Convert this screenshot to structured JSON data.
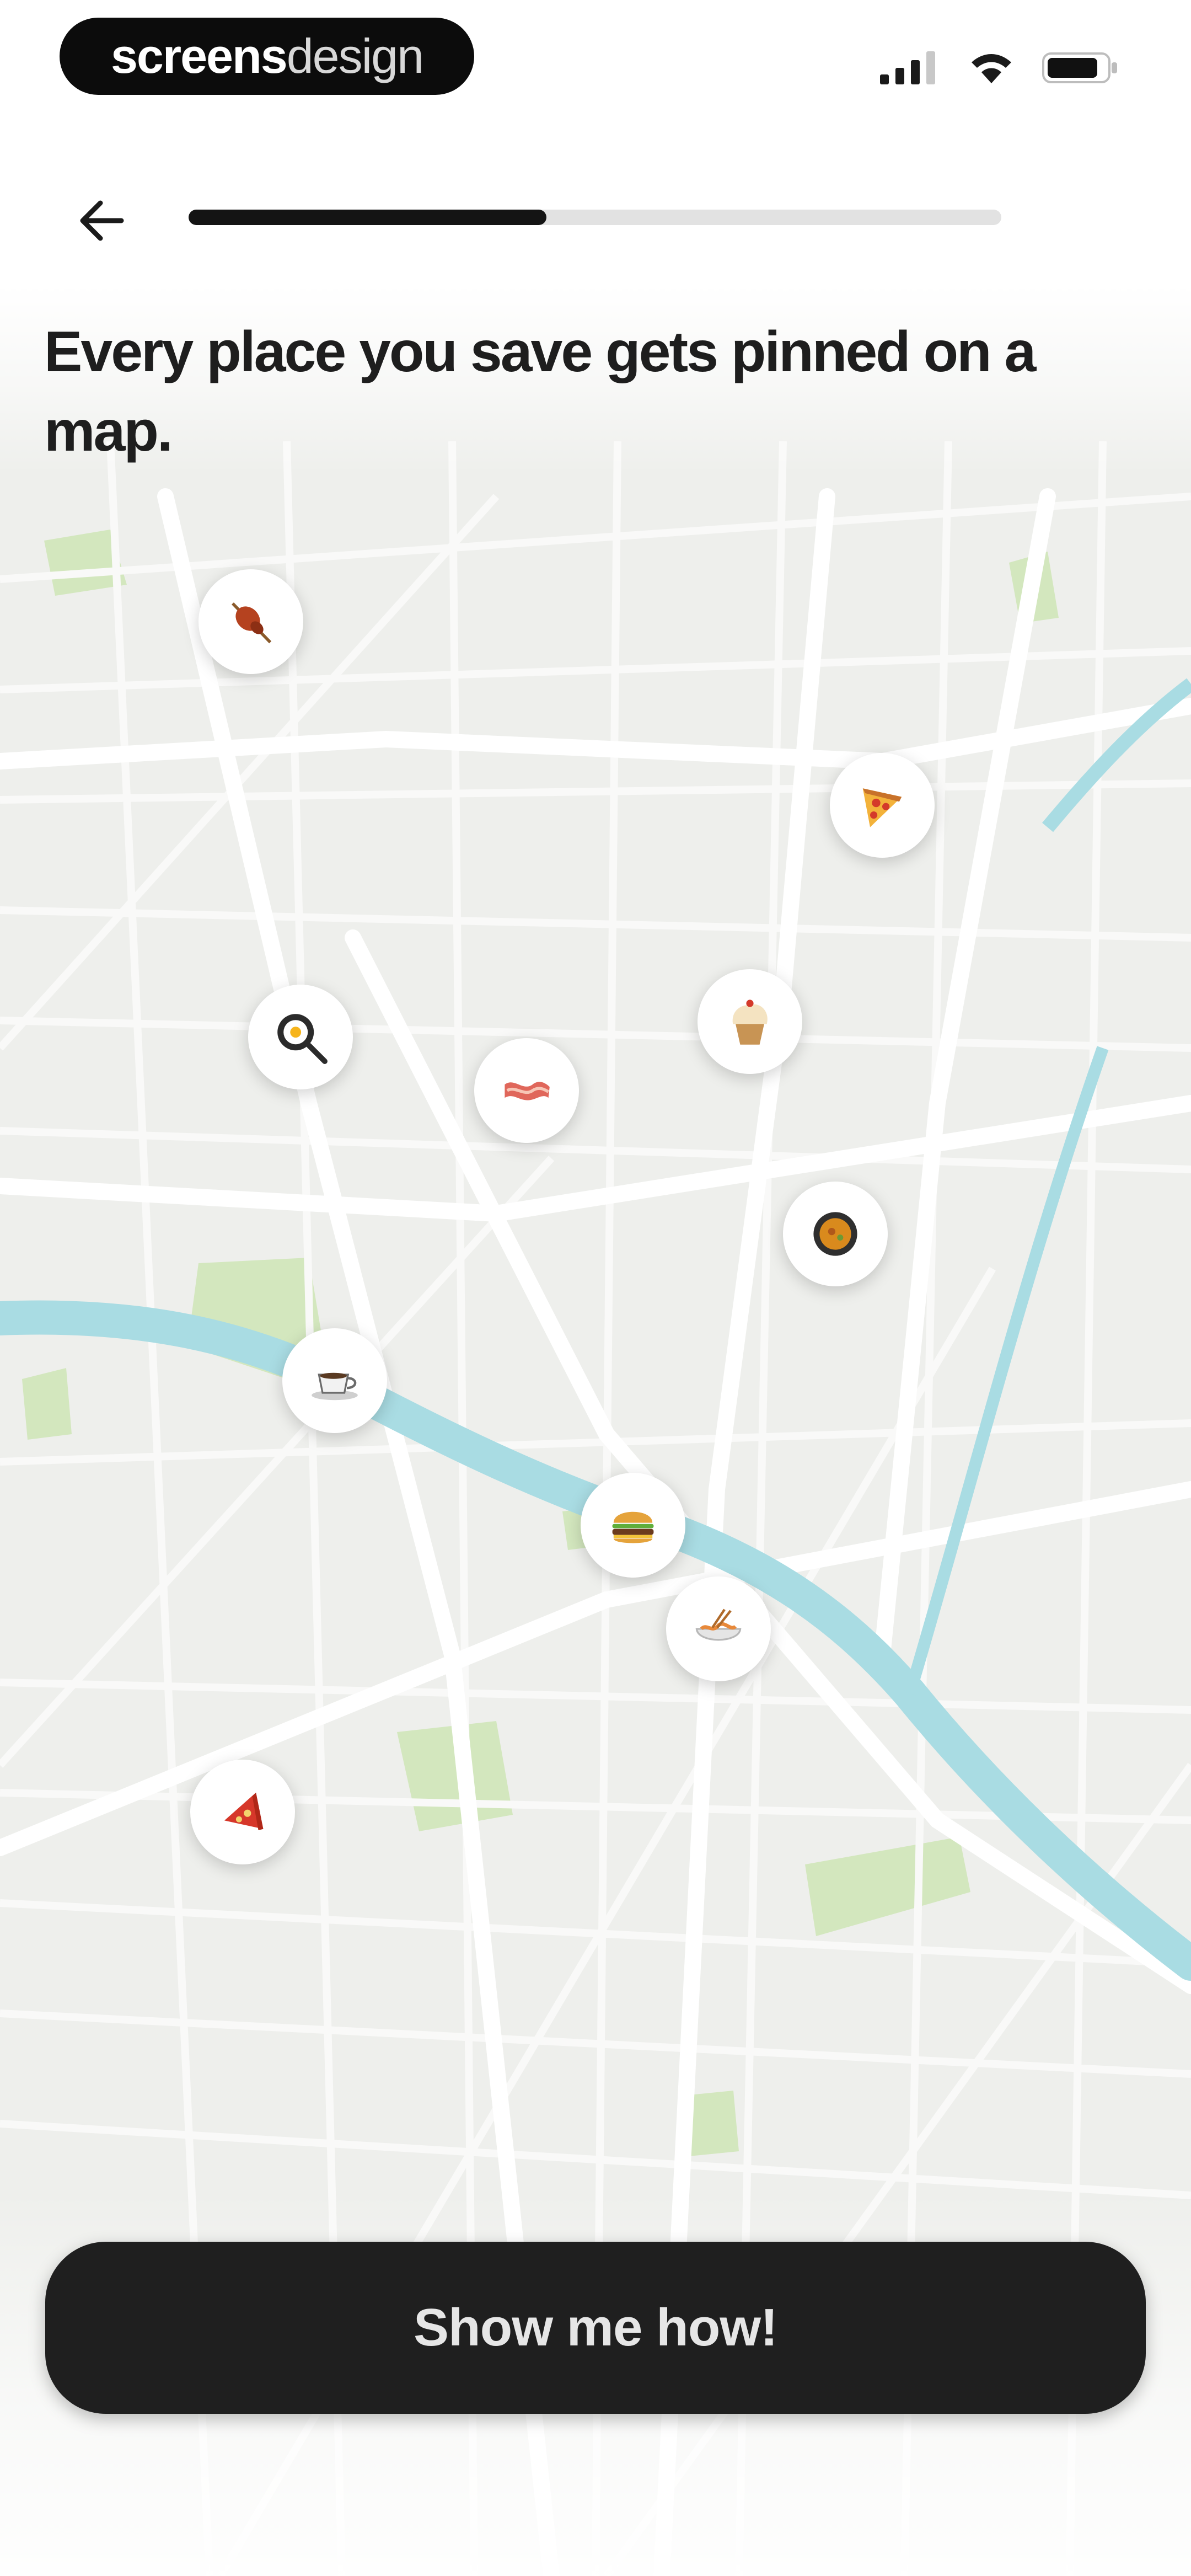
{
  "status_bar": {
    "brand_bold": "screens",
    "brand_light": "design",
    "signal_icon": "cellular-signal-icon",
    "wifi_icon": "wifi-icon",
    "battery_icon": "battery-icon"
  },
  "header": {
    "back_icon": "arrow-left-icon",
    "progress_fraction": 0.44
  },
  "headline": "Every place you save gets pinned on a map.",
  "map": {
    "water_color": "#a9dce3",
    "park_color": "#cfe5b8",
    "road_color": "#ffffff",
    "land_color": "#eeefec"
  },
  "pins": [
    {
      "icon": "meat-skewer-icon"
    },
    {
      "icon": "pizza-slice-icon"
    },
    {
      "icon": "frying-pan-egg-icon"
    },
    {
      "icon": "cupcake-icon"
    },
    {
      "icon": "bacon-icon"
    },
    {
      "icon": "curry-bowl-icon"
    },
    {
      "icon": "coffee-cup-icon"
    },
    {
      "icon": "burger-icon"
    },
    {
      "icon": "noodle-bowl-icon"
    },
    {
      "icon": "pizza-slice-icon"
    }
  ],
  "cta": {
    "label": "Show me how!"
  }
}
